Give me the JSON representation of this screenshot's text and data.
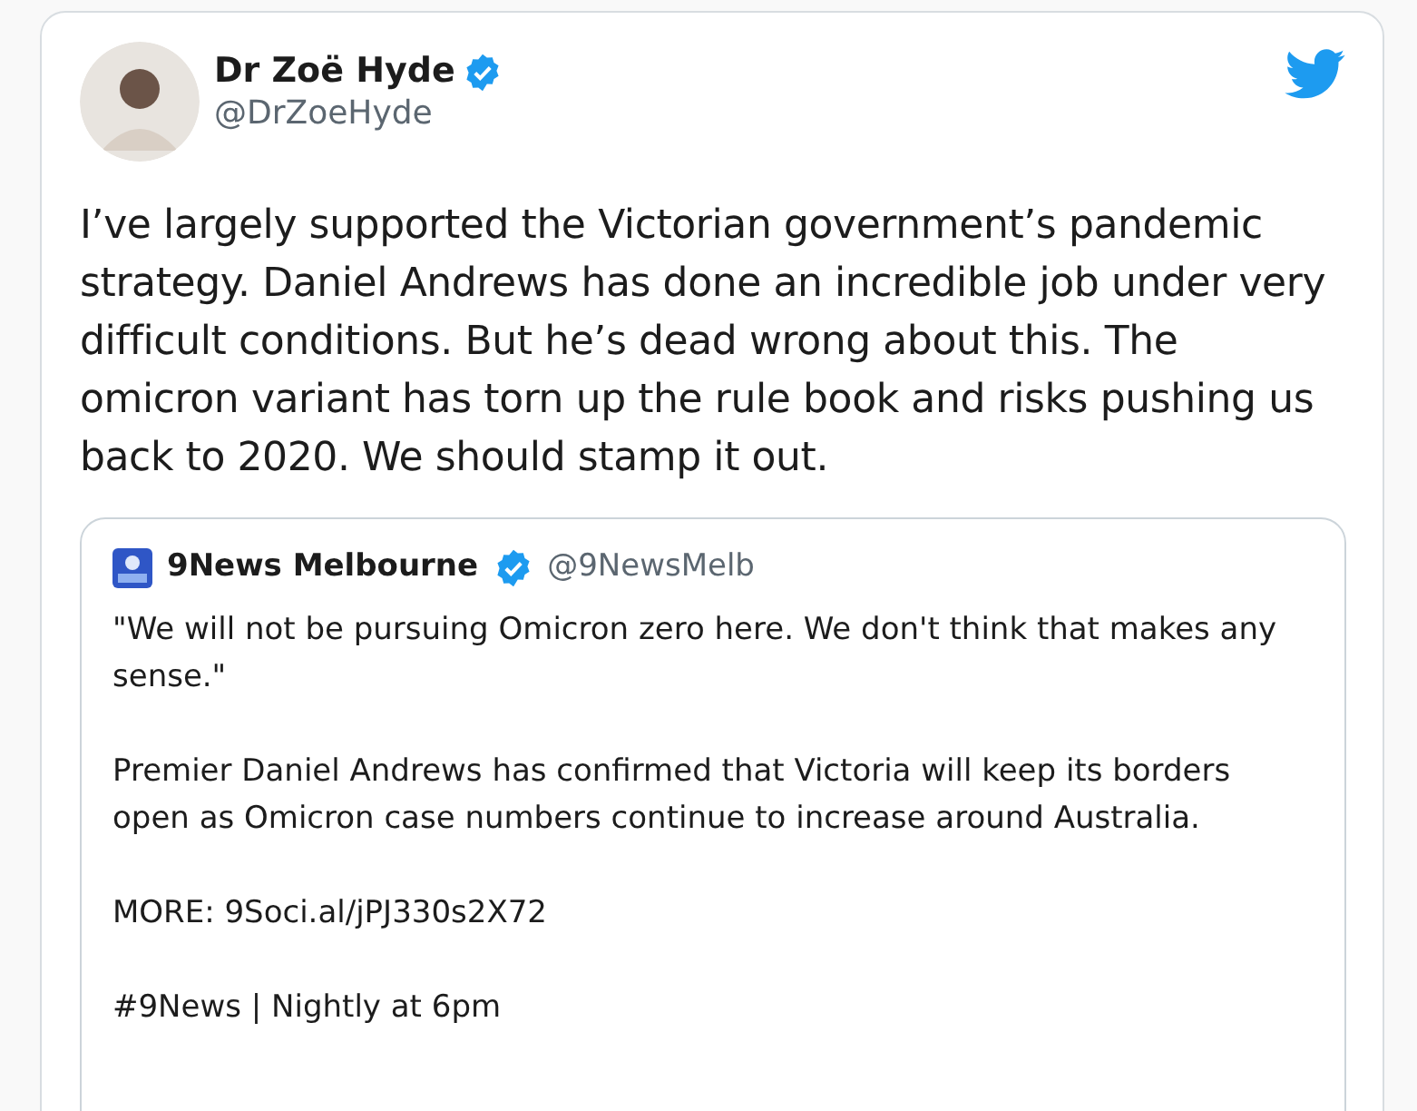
{
  "author": {
    "name": "Dr Zoë Hyde",
    "verified": true,
    "handle": "@DrZoeHyde"
  },
  "text": "I’ve largely supported the Victorian government’s pandemic strategy. Daniel Andrews has done an incredible job under very difficult conditions. But he’s dead wrong about this. The omicron variant has torn up the rule book and risks pushing us back to 2020. We should stamp it out.",
  "quoted": {
    "author": {
      "name": "9News Melbourne",
      "verified": true,
      "handle": "@9NewsMelb"
    },
    "paragraphs": [
      "\"We will not be pursuing Omicron zero here. We don't think that makes any sense.\"",
      "Premier Daniel Andrews has confirmed that Victoria will keep its borders open as Omicron case numbers continue to increase around Australia.",
      "MORE: 9Soci.al/jPJ330s2X72",
      "#9News | Nightly at 6pm"
    ]
  }
}
